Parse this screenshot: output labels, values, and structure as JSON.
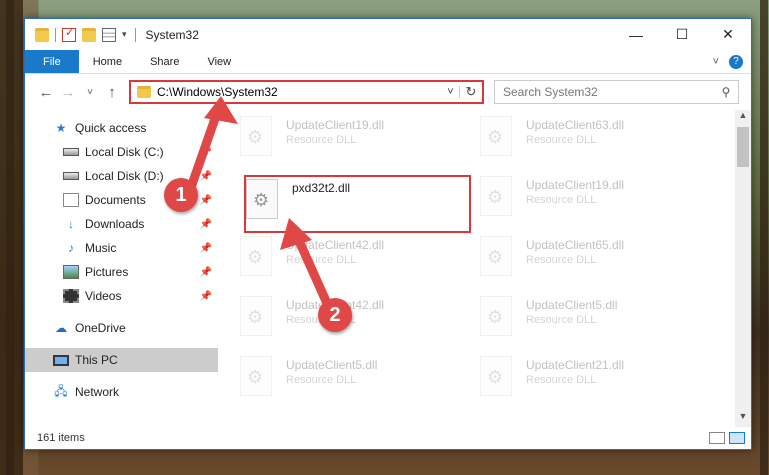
{
  "window": {
    "title": "System32",
    "controls": {
      "minimize": "—",
      "maximize": "☐",
      "close": "✕"
    }
  },
  "ribbon": {
    "tabs": [
      "File",
      "Home",
      "Share",
      "View"
    ]
  },
  "navigation": {
    "back": "←",
    "forward": "→",
    "recent": "˅",
    "up": "↑",
    "address": "C:\\Windows\\System32",
    "search_placeholder": "Search System32"
  },
  "sidebar": {
    "quick_access": "Quick access",
    "items": [
      {
        "label": "Local Disk (C:)",
        "icon": "drive-icon"
      },
      {
        "label": "Local Disk (D:)",
        "icon": "drive-icon"
      },
      {
        "label": "Documents",
        "icon": "documents-icon"
      },
      {
        "label": "Downloads",
        "icon": "downloads-icon"
      },
      {
        "label": "Music",
        "icon": "music-icon"
      },
      {
        "label": "Pictures",
        "icon": "pictures-icon"
      },
      {
        "label": "Videos",
        "icon": "videos-icon"
      }
    ],
    "onedrive": "OneDrive",
    "this_pc": "This PC",
    "network": "Network"
  },
  "files": {
    "left": [
      {
        "name": "UpdateClient19.dll",
        "type": "Resource DLL"
      },
      {
        "name": "pxd32t2.dll",
        "type": ""
      },
      {
        "name": "UpdateClient42.dll",
        "type": "Resource DLL"
      },
      {
        "name": "UpdateClient42.dll",
        "type": "Resource DLL"
      },
      {
        "name": "UpdateClient5.dll",
        "type": "Resource DLL"
      }
    ],
    "right": [
      {
        "name": "UpdateClient63.dll",
        "type": "Resource DLL"
      },
      {
        "name": "UpdateClient19.dll",
        "type": "Resource DLL"
      },
      {
        "name": "UpdateClient65.dll",
        "type": "Resource DLL"
      },
      {
        "name": "UpdateClient5.dll",
        "type": "Resource DLL"
      },
      {
        "name": "UpdateClient21.dll",
        "type": "Resource DLL"
      }
    ]
  },
  "status": {
    "item_count": "161 items"
  },
  "annotations": {
    "step1": "1",
    "step2": "2",
    "color": "#e04747"
  }
}
